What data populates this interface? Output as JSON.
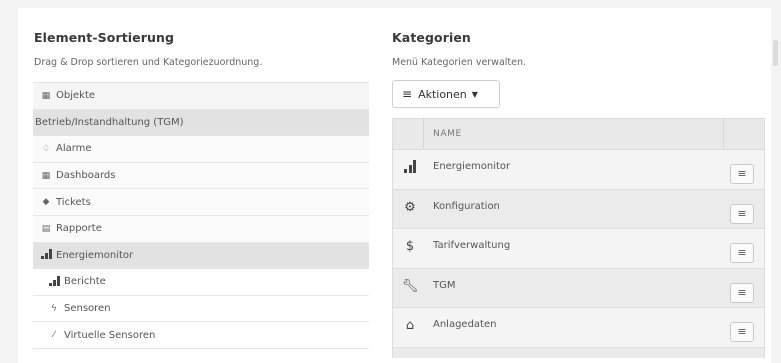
{
  "left": {
    "title": "Element-Sortierung",
    "subtitle": "Drag & Drop sortieren und Kategoriezuordnung.",
    "items": [
      {
        "label": "Objekte",
        "icon": "building-icon"
      },
      {
        "label": "Betrieb/Instandhaltung (TGM)",
        "icon": ""
      },
      {
        "label": "Alarme",
        "icon": "bell-icon"
      },
      {
        "label": "Dashboards",
        "icon": "dashboard-icon"
      },
      {
        "label": "Tickets",
        "icon": "ticket-icon"
      },
      {
        "label": "Rapporte",
        "icon": "document-icon"
      },
      {
        "label": "Energiemonitor",
        "icon": "signal-icon"
      },
      {
        "label": "Berichte",
        "icon": "signal-icon"
      },
      {
        "label": "Sensoren",
        "icon": "bolt-icon"
      },
      {
        "label": "Virtuelle Sensoren",
        "icon": "wand-icon"
      }
    ]
  },
  "right": {
    "title": "Kategorien",
    "subtitle": "Menü Kategorien verwalten.",
    "actions_label": "Aktionen",
    "table_header": "NAME",
    "rows": [
      {
        "name": "Energiemonitor",
        "icon": "signal-icon"
      },
      {
        "name": "Konfiguration",
        "icon": "gears-icon"
      },
      {
        "name": "Tarifverwaltung",
        "icon": "dollar-icon"
      },
      {
        "name": "TGM",
        "icon": "wrench-icon"
      },
      {
        "name": "Anlagedaten",
        "icon": "house-icon"
      }
    ]
  }
}
